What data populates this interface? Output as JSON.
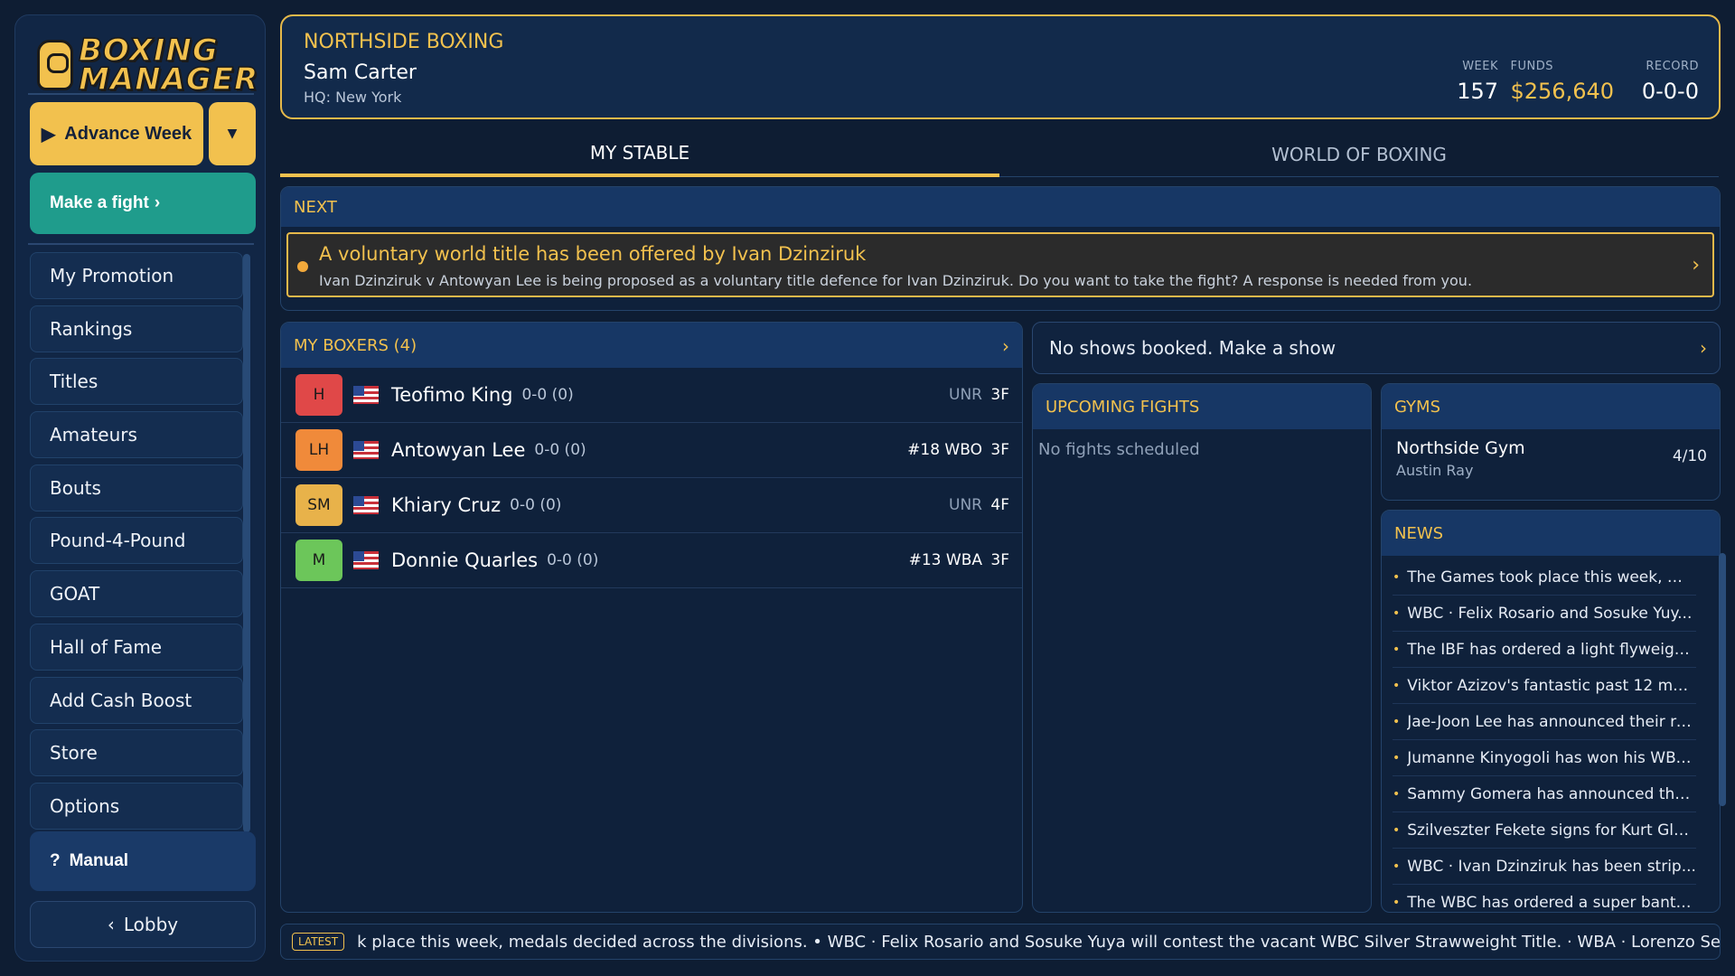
{
  "sidebar": {
    "logo_line1": "BOXING",
    "logo_line2": "MANAGER",
    "advance_label": "Advance Week",
    "fight_label": "Make a fight",
    "nav": [
      "My Promotion",
      "Rankings",
      "Titles",
      "Amateurs",
      "Bouts",
      "Pound-4-Pound",
      "GOAT",
      "Hall of Fame",
      "Add Cash Boost",
      "Store",
      "Options"
    ],
    "manual_label": "Manual",
    "lobby_label": "Lobby"
  },
  "header": {
    "org": "NORTHSIDE BOXING",
    "manager": "Sam Carter",
    "hq": "HQ: New York",
    "week_label": "WEEK",
    "week_value": "157",
    "funds_label": "FUNDS",
    "funds_value": "$256,640",
    "record_label": "RECORD",
    "record_value": "0-0-0"
  },
  "tabs": {
    "stable": "MY STABLE",
    "world": "WORLD OF BOXING"
  },
  "next": {
    "heading": "NEXT",
    "title": "A voluntary world title has been offered by Ivan Dzinziruk",
    "text": "Ivan Dzinziruk v Antowyan Lee is being proposed as a voluntary title defence for  Ivan Dzinziruk. Do you want to take the fight? A response is needed from you."
  },
  "boxers": {
    "heading": "MY BOXERS (4)",
    "rows": [
      {
        "weight": "H",
        "color": "#e04848",
        "name": "Teofimo King",
        "record": "0-0 (0)",
        "rank": "UNR",
        "stamina": "3F"
      },
      {
        "weight": "LH",
        "color": "#f08a3a",
        "name": "Antowyan Lee",
        "record": "0-0 (0)",
        "rank": "#18 WBO",
        "stamina": "3F"
      },
      {
        "weight": "SM",
        "color": "#e8b24a",
        "name": "Khiary Cruz",
        "record": "0-0 (0)",
        "rank": "UNR",
        "stamina": "4F"
      },
      {
        "weight": "M",
        "color": "#6cc65a",
        "name": "Donnie Quarles",
        "record": "0-0 (0)",
        "rank": "#13 WBA",
        "stamina": "3F"
      }
    ]
  },
  "shows": {
    "label": "No shows booked. Make a show"
  },
  "fights": {
    "heading": "UPCOMING FIGHTS",
    "empty": "No fights scheduled"
  },
  "gyms": {
    "heading": "GYMS",
    "name": "Northside Gym",
    "owner": "Austin Ray",
    "capacity": "4/10"
  },
  "news": {
    "heading": "NEWS",
    "items": [
      "The Games took place this week, me...",
      "WBC  ·  Felix Rosario and Sosuke Yuy...",
      "The IBF has ordered a light flyweight...",
      "Viktor Azizov's fantastic past 12 mo...",
      "Jae-Joon Lee has announced their re...",
      "Jumanne Kinyogoli has won his WBC...",
      "Sammy Gomera has announced thei...",
      "Szilveszter Fekete signs for Kurt Glo...",
      "WBC  ·  Ivan Dzinziruk has been strip...",
      "The WBC has ordered a super banta..."
    ]
  },
  "ticker": {
    "badge": "LATEST",
    "text": "k place this week, medals decided across the divisions.  •  WBC  ·  Felix Rosario and Sosuke Yuya will contest the vacant WBC Silver Strawweight Title.  ·  WBA  ·  Lorenzo Serrano vac"
  },
  "colors": {
    "accent": "#f2c14e",
    "teal": "#1f9c8c",
    "panel": "#0f213b"
  }
}
